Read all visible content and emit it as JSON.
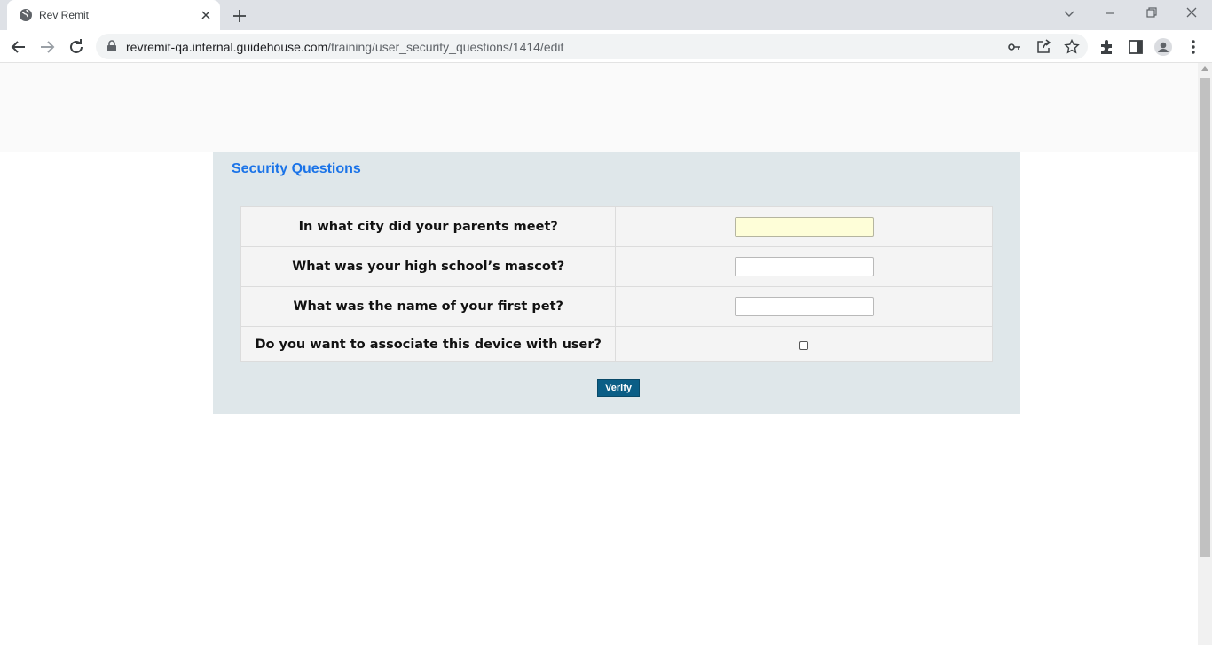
{
  "browser": {
    "tab_title": "Rev Remit",
    "url_host": "revremit-qa.internal.guidehouse.com",
    "url_path": "/training/user_security_questions/1414/edit"
  },
  "page": {
    "title": "Security Questions",
    "questions": [
      {
        "label": "In what city did your parents meet?",
        "value": ""
      },
      {
        "label": "What was your high school’s mascot?",
        "value": ""
      },
      {
        "label": "What was the name of your first pet?",
        "value": ""
      }
    ],
    "associate_device_label": "Do you want to associate this device with user?",
    "associate_device_checked": false,
    "verify_label": "Verify"
  },
  "colors": {
    "panel_bg": "#dfe7ea",
    "title": "#1a73e8",
    "button_bg": "#0b5e86",
    "active_input_bg": "#fefed8"
  }
}
